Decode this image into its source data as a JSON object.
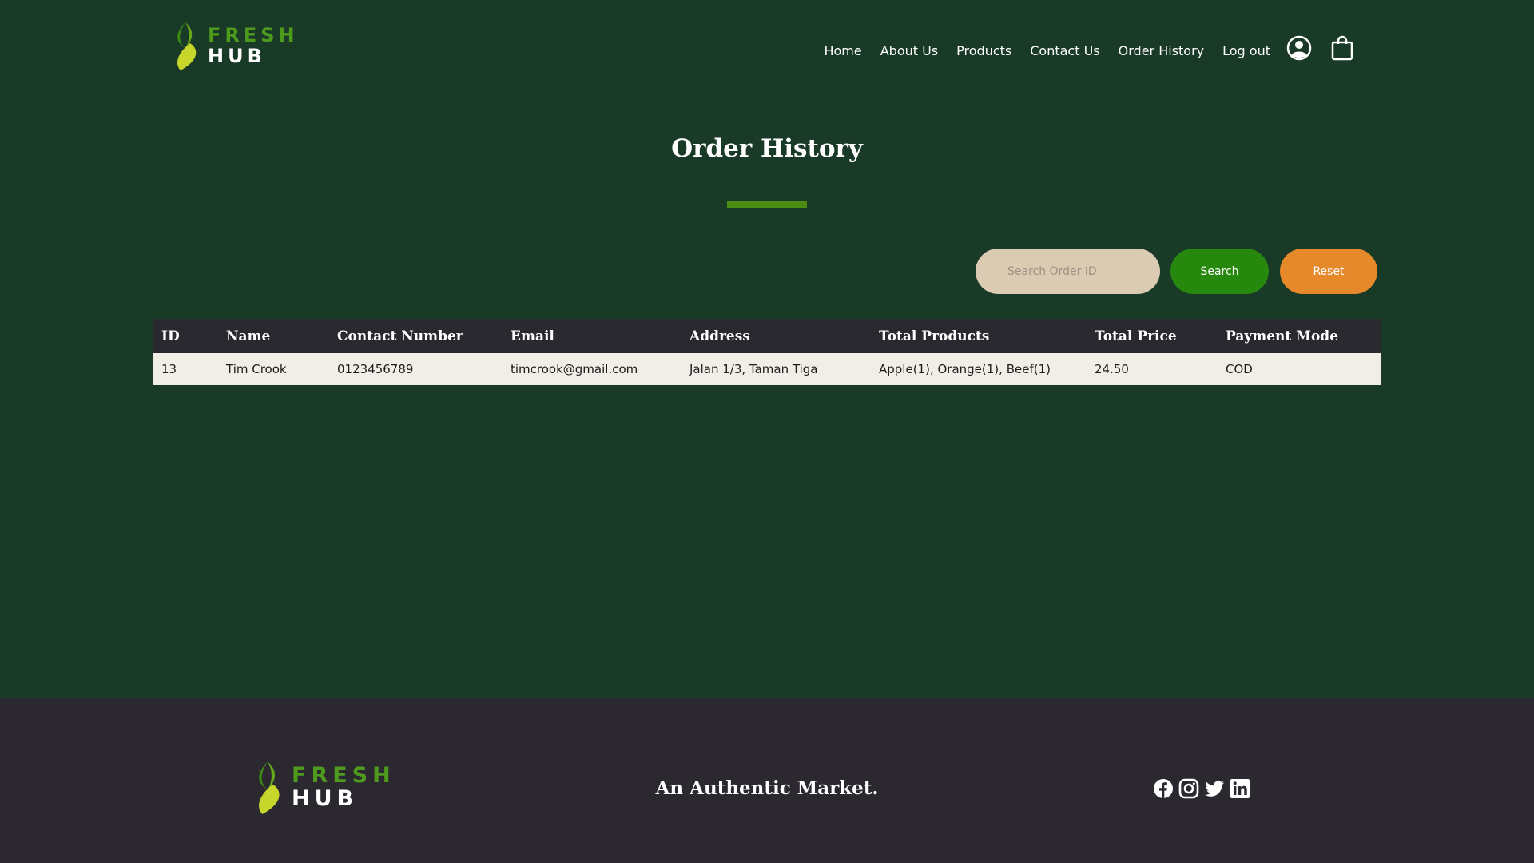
{
  "brand": {
    "fresh": "FRESH",
    "hub": "HUB"
  },
  "nav": {
    "items": [
      "Home",
      "About Us",
      "Products",
      "Contact Us",
      "Order History",
      "Log out"
    ]
  },
  "header_icons": {
    "user": "user-circle-icon",
    "cart": "shopping-bag-icon"
  },
  "page": {
    "title": "Order History"
  },
  "search": {
    "placeholder": "Search Order ID",
    "search_label": "Search",
    "reset_label": "Reset"
  },
  "table": {
    "headers": [
      "ID",
      "Name",
      "Contact Number",
      "Email",
      "Address",
      "Total Products",
      "Total Price",
      "Payment Mode"
    ],
    "rows": [
      [
        "13",
        "Tim Crook",
        "0123456789",
        "timcrook@gmail.com",
        "Jalan 1/3, Taman Tiga",
        "Apple(1), Orange(1), Beef(1)",
        "24.50",
        "COD"
      ]
    ]
  },
  "footer": {
    "tagline": "An Authentic Market.",
    "socials": [
      "facebook-icon",
      "instagram-icon",
      "twitter-icon",
      "linkedin-icon"
    ]
  },
  "colors": {
    "background": "#1a3a28",
    "footer": "#2b2830",
    "accent_green": "#27880e",
    "reset_orange": "#e5892a",
    "search_field": "#dccbb3"
  }
}
